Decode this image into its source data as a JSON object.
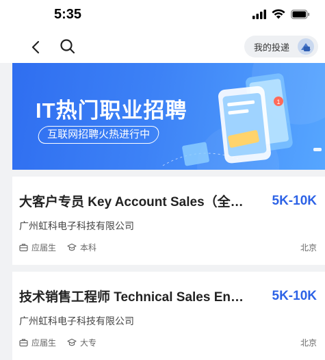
{
  "status_bar": {
    "time": "5:35"
  },
  "nav": {
    "back_icon": "chevron-left-icon",
    "search_icon": "search-icon",
    "my_applications_label": "我的投递"
  },
  "banner": {
    "title": "IT热门职业招聘",
    "subtitle": "互联网招聘火热进行中"
  },
  "jobs": [
    {
      "title": "大客户专员 Key Account Sales（全…",
      "salary": "5K-10K",
      "company": "广州虹科电子科技有限公司",
      "tags": [
        "应届生",
        "本科"
      ],
      "location": "北京"
    },
    {
      "title": "技术销售工程师 Technical Sales En…",
      "salary": "5K-10K",
      "company": "广州虹科电子科技有限公司",
      "tags": [
        "应届生",
        "大专"
      ],
      "location": "北京"
    }
  ],
  "colors": {
    "accent": "#2c62e6",
    "banner": "#3d82f6",
    "background": "#f1f2f4"
  }
}
